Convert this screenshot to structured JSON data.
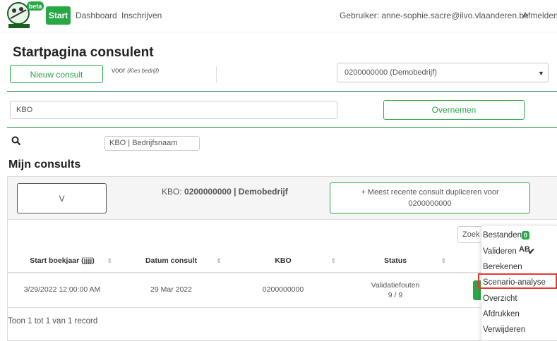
{
  "nav": {
    "logo_badge": "beta",
    "start_label": "Start",
    "dashboard_label": "Dashboard",
    "inschrijven_label": "Inschrijven",
    "user_text": "Gebruiker: anne-sophie.sacre@ilvo.vlaanderen.be",
    "logout_label": "Afmelden"
  },
  "page": {
    "title": "Startpagina consulent",
    "new_consult_label": "Nieuw consult",
    "voor_label": "voor",
    "voor_hint": "(Kies bedrijf)",
    "company_select_value": "0200000000 (Demobedrijf)"
  },
  "kbo_form": {
    "kbo_placeholder": "KBO",
    "overnemen_label": "Overnemen",
    "search_placeholder": "KBO | Bedrijfsnaam"
  },
  "consults": {
    "section_title": "Mijn consults",
    "v_button_label": "V",
    "kbo_prefix": "KBO:",
    "kbo_value": "0200000000 | Demobedrijf",
    "duplicate_label_line1": "+ Meest recente consult dupliceren voor",
    "duplicate_label_line2": "0200000000",
    "search_partial": "Zoek",
    "table": {
      "columns": [
        "Start boekjaar (jjjj)",
        "Datum consult",
        "KBO",
        "Status"
      ],
      "rows": [
        {
          "start_boekjaar": "3/29/2022 12:00:00 AM",
          "datum_consult": "29 Mar 2022",
          "kbo": "0200000000",
          "status_line1": "Validatiefouten",
          "status_line2": "9 / 9"
        }
      ]
    },
    "footer": "Toon 1 tot 1 van 1 record"
  },
  "dropdown": {
    "bestanden_label": "Bestanden",
    "bestanden_badge": "0",
    "valideren_label": "Valideren",
    "valideren_icon": "AB",
    "berekenen_label": "Berekenen",
    "scenario_label": "Scenario-analyse",
    "overzicht_label": "Overzicht",
    "afdrukken_label": "Afdrukken",
    "verwijderen_label": "Verwijderen"
  },
  "colors": {
    "accent_green": "#28a745",
    "highlight_red": "#e53935"
  }
}
